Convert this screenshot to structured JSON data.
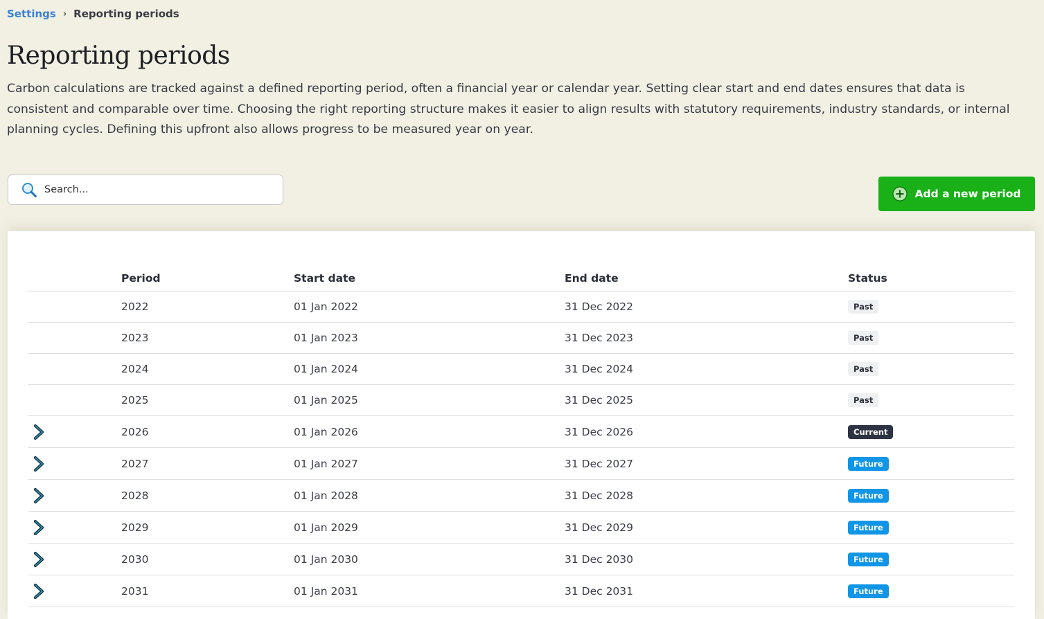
{
  "breadcrumb": {
    "parent": "Settings",
    "separator": "›",
    "current": "Reporting periods"
  },
  "page": {
    "title": "Reporting periods",
    "description": "Carbon calculations are tracked against a defined reporting period, often a financial year or calendar year. Setting clear start and end dates ensures that data is consistent and comparable over time. Choosing the right reporting structure makes it easier to align results with statutory requirements, industry standards, or internal planning cycles. Defining this upfront also allows progress to be measured year on year."
  },
  "search": {
    "placeholder": "Search...",
    "icon": "magnifier-icon"
  },
  "add_button": {
    "label": "Add a new period",
    "icon": "plus-circle-icon"
  },
  "table": {
    "headers": {
      "period": "Period",
      "start": "Start date",
      "end": "End date",
      "status": "Status"
    },
    "rows": [
      {
        "period": "2022",
        "start": "01 Jan 2022",
        "end": "31 Dec 2022",
        "status": "Past",
        "expandable": false
      },
      {
        "period": "2023",
        "start": "01 Jan 2023",
        "end": "31 Dec 2023",
        "status": "Past",
        "expandable": false
      },
      {
        "period": "2024",
        "start": "01 Jan 2024",
        "end": "31 Dec 2024",
        "status": "Past",
        "expandable": false
      },
      {
        "period": "2025",
        "start": "01 Jan 2025",
        "end": "31 Dec 2025",
        "status": "Past",
        "expandable": false
      },
      {
        "period": "2026",
        "start": "01 Jan 2026",
        "end": "31 Dec 2026",
        "status": "Current",
        "expandable": true
      },
      {
        "period": "2027",
        "start": "01 Jan 2027",
        "end": "31 Dec 2027",
        "status": "Future",
        "expandable": true
      },
      {
        "period": "2028",
        "start": "01 Jan 2028",
        "end": "31 Dec 2028",
        "status": "Future",
        "expandable": true
      },
      {
        "period": "2029",
        "start": "01 Jan 2029",
        "end": "31 Dec 2029",
        "status": "Future",
        "expandable": true
      },
      {
        "period": "2030",
        "start": "01 Jan 2030",
        "end": "31 Dec 2030",
        "status": "Future",
        "expandable": true
      },
      {
        "period": "2031",
        "start": "01 Jan 2031",
        "end": "31 Dec 2031",
        "status": "Future",
        "expandable": true
      }
    ]
  },
  "colors": {
    "background": "#f2f0e3",
    "link": "#3b82d6",
    "primary_button": "#19b018",
    "badge_past": "#eef0f2",
    "badge_current": "#2e3344",
    "badge_future": "#1195e6",
    "chevron": "#1f6f8b"
  }
}
